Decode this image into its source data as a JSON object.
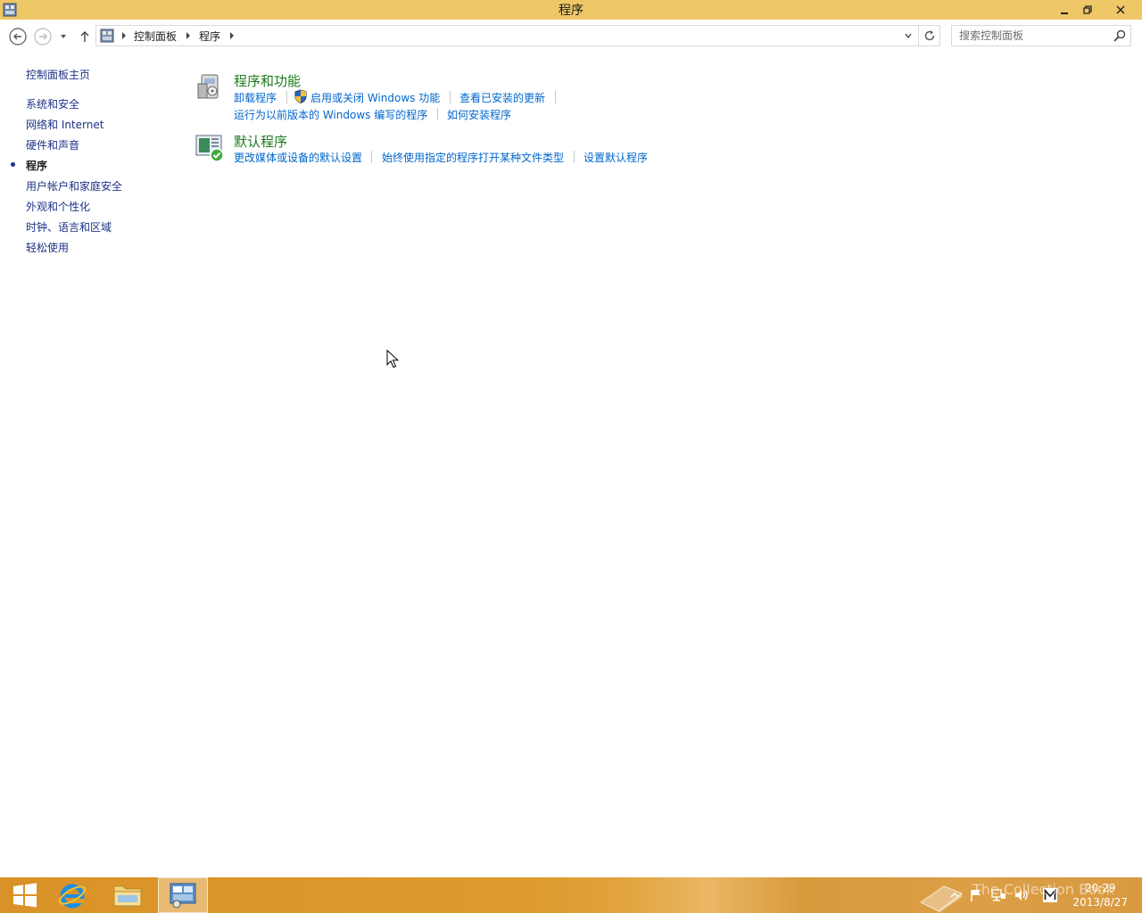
{
  "window": {
    "title": "程序"
  },
  "nav": {
    "breadcrumb": [
      "控制面板",
      "程序"
    ],
    "search_placeholder": "搜索控制面板"
  },
  "sidebar": {
    "home": "控制面板主页",
    "items": [
      {
        "label": "系统和安全",
        "active": false
      },
      {
        "label": "网络和 Internet",
        "active": false
      },
      {
        "label": "硬件和声音",
        "active": false
      },
      {
        "label": "程序",
        "active": true
      },
      {
        "label": "用户帐户和家庭安全",
        "active": false
      },
      {
        "label": "外观和个性化",
        "active": false
      },
      {
        "label": "时钟、语言和区域",
        "active": false
      },
      {
        "label": "轻松使用",
        "active": false
      }
    ]
  },
  "categories": [
    {
      "title": "程序和功能",
      "links": [
        "卸载程序",
        "启用或关闭 Windows 功能",
        "查看已安装的更新",
        "运行为以前版本的 Windows 编写的程序",
        "如何安装程序"
      ]
    },
    {
      "title": "默认程序",
      "links": [
        "更改媒体或设备的默认设置",
        "始终使用指定的程序打开某种文件类型",
        "设置默认程序"
      ]
    }
  ],
  "taskbar": {
    "time": "20:29",
    "date": "2013/8/27",
    "watermark": "The Collection Book"
  },
  "colors": {
    "titlebar": "#eec866",
    "link": "#0066cc",
    "category_title": "#1e7a1e",
    "nav_link": "#1e3287"
  }
}
